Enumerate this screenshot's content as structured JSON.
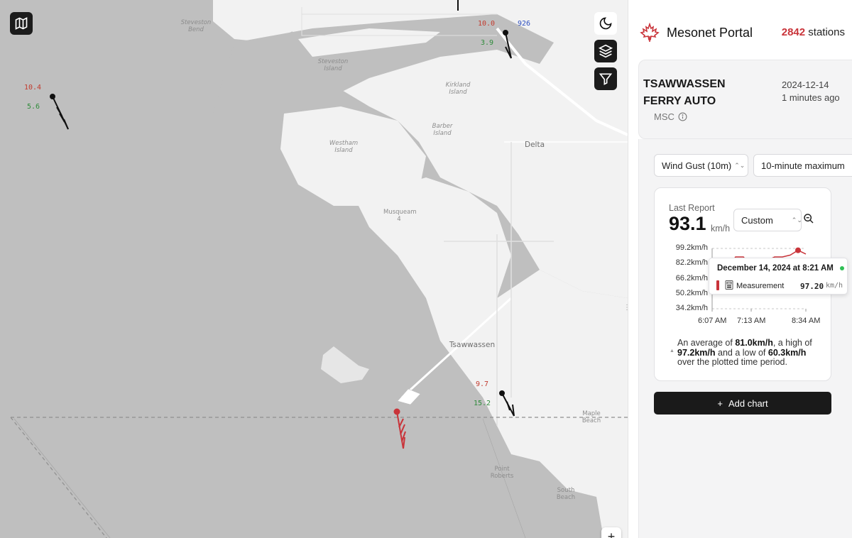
{
  "map": {
    "labels": {
      "steveston_bend": "Steveston\nBend",
      "steveston_island": "Steveston\nIsland",
      "kirkland_island": "Kirkland\nIsland",
      "barber_island": "Barber\nIsland",
      "westham_island": "Westham\nIsland",
      "delta": "Delta",
      "musqueam": "Musqueam\n4",
      "tsawwassen": "Tsawwassen",
      "maple_beach": "Maple\nBeach",
      "point_roberts": "Point\nRoberts",
      "south_beach": "South\nBeach"
    },
    "stations": [
      {
        "id": "sta-west",
        "top_value": "10.4",
        "bottom_value": "5.6"
      },
      {
        "id": "sta-north",
        "top_value": "10.0",
        "bottom_value": "3.9",
        "side_value": "926"
      },
      {
        "id": "sta-south",
        "top_value": "9.7",
        "bottom_value": "15.2"
      }
    ],
    "buttons": {
      "layers": "map-icon",
      "theme": "moon-icon",
      "layers2": "layers-icon",
      "filter": "filter-icon",
      "zoom_in": "+"
    },
    "colors": {
      "water": "#bfbfbf",
      "land": "#f2f2f2",
      "selected_station": "#c9343a"
    }
  },
  "panel": {
    "brand_title": "Mesonet Portal",
    "station_count": "2842",
    "station_count_suffix": "stations",
    "station": {
      "name": "TSAWWASSEN FERRY AUTO",
      "network": "MSC",
      "date": "2024-12-14",
      "ago": "1 minutes ago"
    },
    "variable_select": "Wind Gust (10m)",
    "aggregation_select": "10-minute maximum",
    "last_report_label": "Last Report",
    "last_report_value": "93.1",
    "last_report_unit": "km/h",
    "range_select": "Custom",
    "tooltip": {
      "date": "December 14, 2024 at 8:21 AM",
      "series_label": "Measurement",
      "value": "97.20",
      "unit": "km/h"
    },
    "summary": {
      "prefix": "An average of",
      "avg": "81.0km/h",
      "mid1": ", a high of",
      "high": "97.2km/h",
      "mid2": "and a low of",
      "low": "60.3km/h",
      "suffix": "over the plotted time period."
    },
    "add_chart_label": "Add chart"
  },
  "chart_data": {
    "type": "line",
    "title": "",
    "xlabel": "",
    "ylabel": "",
    "x_ticks": [
      "6:07 AM",
      "7:13 AM",
      "8:34 AM"
    ],
    "y_ticks": [
      "99.2km/h",
      "82.2km/h",
      "66.2km/h",
      "50.2km/h",
      "34.2km/h"
    ],
    "ylim": [
      34.2,
      99.2
    ],
    "series": [
      {
        "color": "#c9343a",
        "x": [
          "6:07 AM",
          "6:30 AM",
          "6:50 AM",
          "7:00 AM",
          "7:05 AM",
          "7:13 AM",
          "7:25 AM",
          "7:40 AM",
          "7:55 AM",
          "8:05 AM",
          "8:10 AM",
          "8:21 AM",
          "8:34 AM"
        ],
        "values": [
          70.0,
          72.0,
          78.0,
          90.0,
          90.0,
          80.0,
          84.0,
          86.0,
          90.0,
          90.0,
          92.0,
          97.2,
          93.1
        ]
      }
    ],
    "highlight": {
      "x": "8:21 AM",
      "value": 97.2
    },
    "grid": true
  }
}
